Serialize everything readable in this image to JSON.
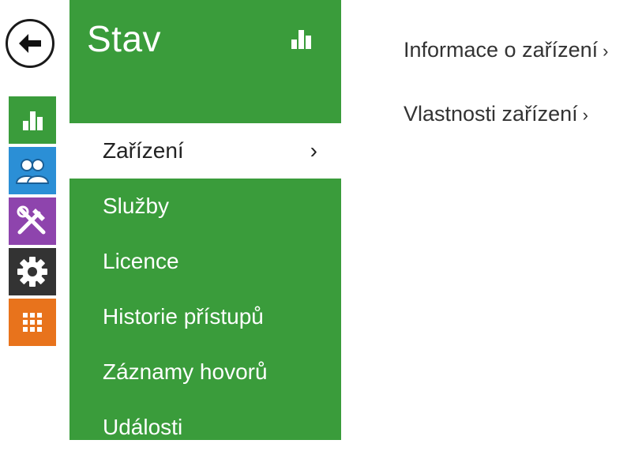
{
  "nav": {
    "back_icon": "arrow-left-icon",
    "rail": [
      {
        "icon": "bar-chart-icon",
        "color": "#3a9c3b"
      },
      {
        "icon": "users-icon",
        "color": "#2b8fd6"
      },
      {
        "icon": "tools-icon",
        "color": "#8e44ad"
      },
      {
        "icon": "gear-icon",
        "color": "#333333"
      },
      {
        "icon": "grid-icon",
        "color": "#e8731c"
      }
    ]
  },
  "panel": {
    "title": "Stav",
    "color": "#3a9c3b",
    "items": [
      {
        "label": "Zařízení",
        "chevron": "›",
        "active": true
      },
      {
        "label": "Služby"
      },
      {
        "label": "Licence"
      },
      {
        "label": "Historie přístupů"
      },
      {
        "label": "Záznamy hovorů"
      },
      {
        "label": "Události"
      }
    ]
  },
  "content": {
    "links": [
      {
        "label": "Informace o zařízení",
        "chevron": "›"
      },
      {
        "label": "Vlastnosti zařízení",
        "chevron": "›"
      }
    ]
  }
}
